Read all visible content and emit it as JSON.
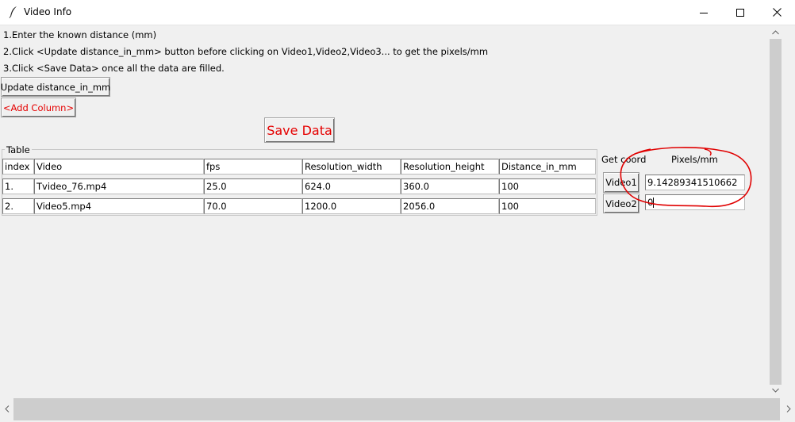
{
  "window": {
    "title": "Video Info"
  },
  "instructions": [
    "1.Enter the known distance (mm)",
    "2.Click <Update distance_in_mm> button before clicking on Video1,Video2,Video3... to get the pixels/mm",
    "3.Click <Save Data> once all the data are filled."
  ],
  "buttons": {
    "update": "Update distance_in_mm",
    "add_column": "<Add Column>",
    "save_data": "Save Data"
  },
  "table": {
    "frame_label": "Table",
    "columns": [
      "index",
      "Video",
      "fps",
      "Resolution_width",
      "Resolution_height",
      "Distance_in_mm"
    ],
    "rows": [
      [
        "1.",
        "Tvideo_76.mp4",
        "25.0",
        "624.0",
        "360.0",
        "100"
      ],
      [
        "2.",
        "Video5.mp4",
        "70.0",
        "1200.0",
        "2056.0",
        "100"
      ]
    ]
  },
  "coords": {
    "get_coord_label": "Get coord",
    "pixels_label": "Pixels/mm",
    "video_buttons": [
      "Video1",
      "Video2"
    ],
    "pixel_values": [
      "9.14289341510662",
      "0"
    ]
  },
  "colors": {
    "accent_red": "#e50000",
    "annotation_circle": "#e00000"
  }
}
